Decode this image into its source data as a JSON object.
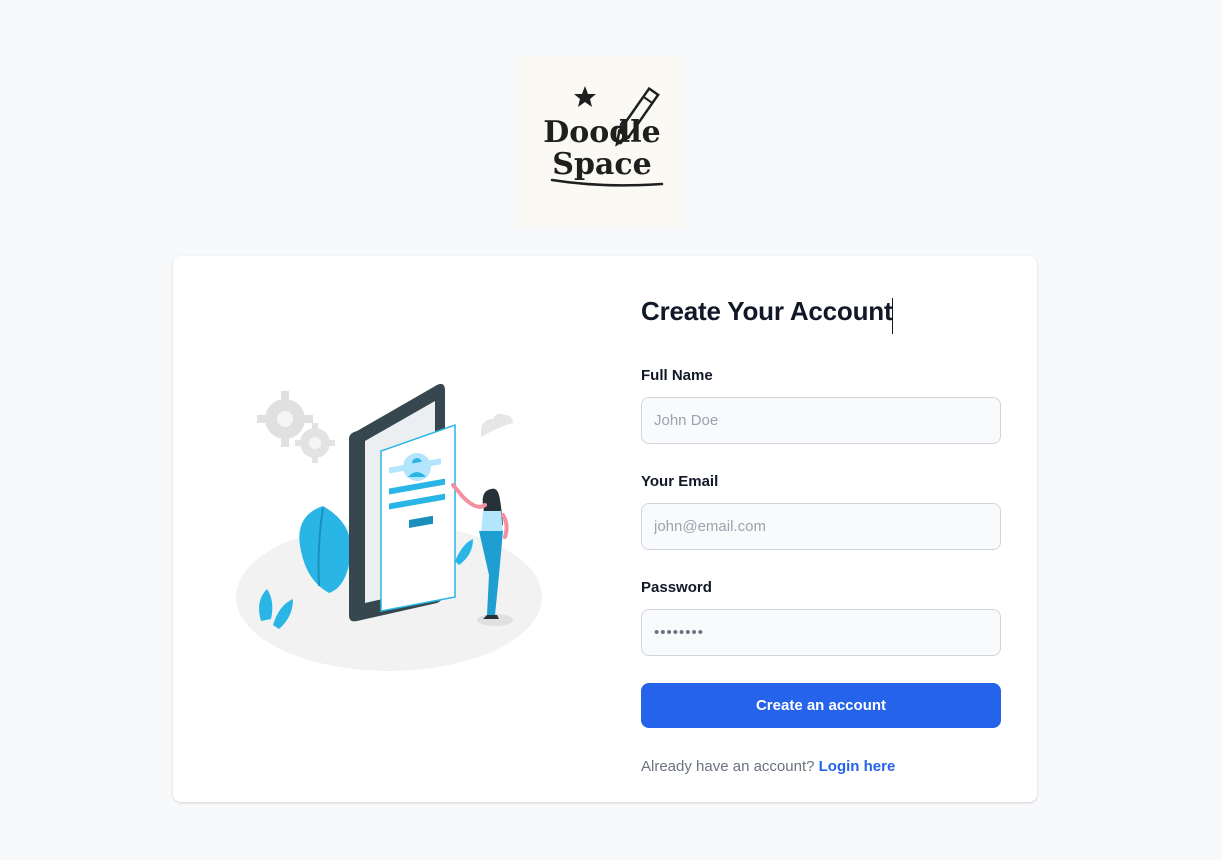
{
  "logo": {
    "line1": "Doodle",
    "line2": "Space",
    "icon": "pencil-star-logo"
  },
  "form": {
    "title": "Create Your Account",
    "name_label": "Full Name",
    "name_placeholder": "John Doe",
    "email_label": "Your Email",
    "email_placeholder": "john@email.com",
    "password_label": "Password",
    "password_placeholder": "••••••••",
    "submit_label": "Create an account",
    "login_prompt": "Already have an account?",
    "login_link": "Login here"
  },
  "colors": {
    "accent": "#2563eb",
    "page_bg": "#f8f9fb",
    "card_bg": "#ffffff",
    "illustration_cyan": "#29b6e6"
  }
}
